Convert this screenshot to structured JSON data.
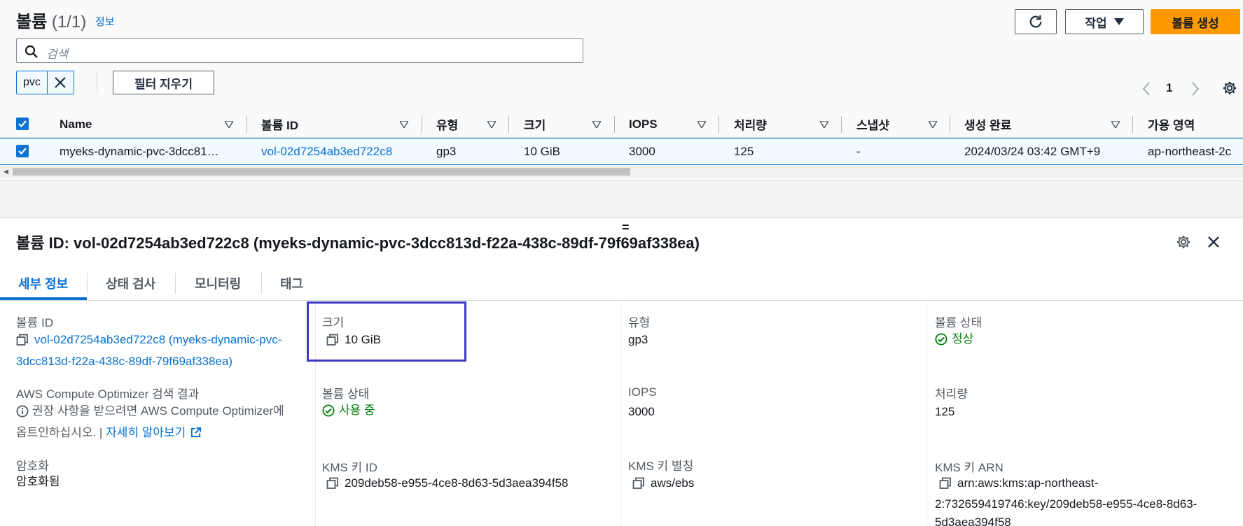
{
  "header": {
    "title": "볼륨",
    "count": "(1/1)",
    "info_link": "정보",
    "actions_label": "작업",
    "create_label": "볼륨 생성"
  },
  "search": {
    "placeholder": "검색"
  },
  "filter": {
    "token": "pvc",
    "clear_label": "필터 지우기"
  },
  "pagination": {
    "current_page": "1"
  },
  "table": {
    "columns": [
      "Name",
      "볼륨 ID",
      "유형",
      "크기",
      "IOPS",
      "처리량",
      "스냅샷",
      "생성 완료",
      "가용 영역"
    ],
    "rows": [
      {
        "name": "myeks-dynamic-pvc-3dcc81…",
        "volume_id": "vol-02d7254ab3ed722c8",
        "type": "gp3",
        "size": "10 GiB",
        "iops": "3000",
        "throughput": "125",
        "snapshot": "-",
        "created": "2024/03/24 03:42 GMT+9",
        "az": "ap-northeast-2c"
      }
    ]
  },
  "detail": {
    "title": "볼륨 ID: vol-02d7254ab3ed722c8 (myeks-dynamic-pvc-3dcc813d-f22a-438c-89df-79f69af338ea)",
    "tabs": [
      "세부 정보",
      "상태 검사",
      "모니터링",
      "태그"
    ],
    "fields": {
      "volume_id_label": "볼륨 ID",
      "volume_id_line1": "vol-02d7254ab3ed722c8 (myeks-dynamic-pvc-",
      "volume_id_line2": "3dcc813d-f22a-438c-89df-79f69af338ea)",
      "size_label": "크기",
      "size_value": "10 GiB",
      "type_label": "유형",
      "type_value": "gp3",
      "vol_state_label": "볼륨 상태",
      "vol_state_value": "정상",
      "optimizer_label": "AWS Compute Optimizer 검색 결과",
      "optimizer_line1": "권장 사항을 받으려면 AWS Compute Optimizer에",
      "optimizer_line2": "옵트인하십시오. |",
      "optimizer_link": "자세히 알아보기",
      "volume_status_label": "볼륨 상태",
      "volume_status_value": "사용 중",
      "iops_label": "IOPS",
      "iops_value": "3000",
      "throughput_label": "처리량",
      "throughput_value": "125",
      "encryption_label": "암호화",
      "encryption_value": "암호화됨",
      "kms_id_label": "KMS 키 ID",
      "kms_id_value": "209deb58-e955-4ce8-8d63-5d3aea394f58",
      "kms_alias_label": "KMS 키 별칭",
      "kms_alias_value": "aws/ebs",
      "kms_arn_label": "KMS 키 ARN",
      "kms_arn_line1": "arn:aws:kms:ap-northeast-",
      "kms_arn_line2": "2:732659419746:key/209deb58-e955-4ce8-8d63-",
      "kms_arn_line3": "5d3aea394f58"
    }
  },
  "colors": {
    "link": "#0972d3",
    "primary": "#ff9900",
    "success": "#037f0c",
    "highlight": "#3b3bc6"
  },
  "icons": [
    "refresh-icon",
    "caret-down-icon",
    "search-icon",
    "close-icon",
    "chevron-left-icon",
    "chevron-right-icon",
    "settings-icon",
    "copy-icon",
    "status-ok-icon",
    "info-icon",
    "external-link-icon",
    "sort-icon"
  ]
}
